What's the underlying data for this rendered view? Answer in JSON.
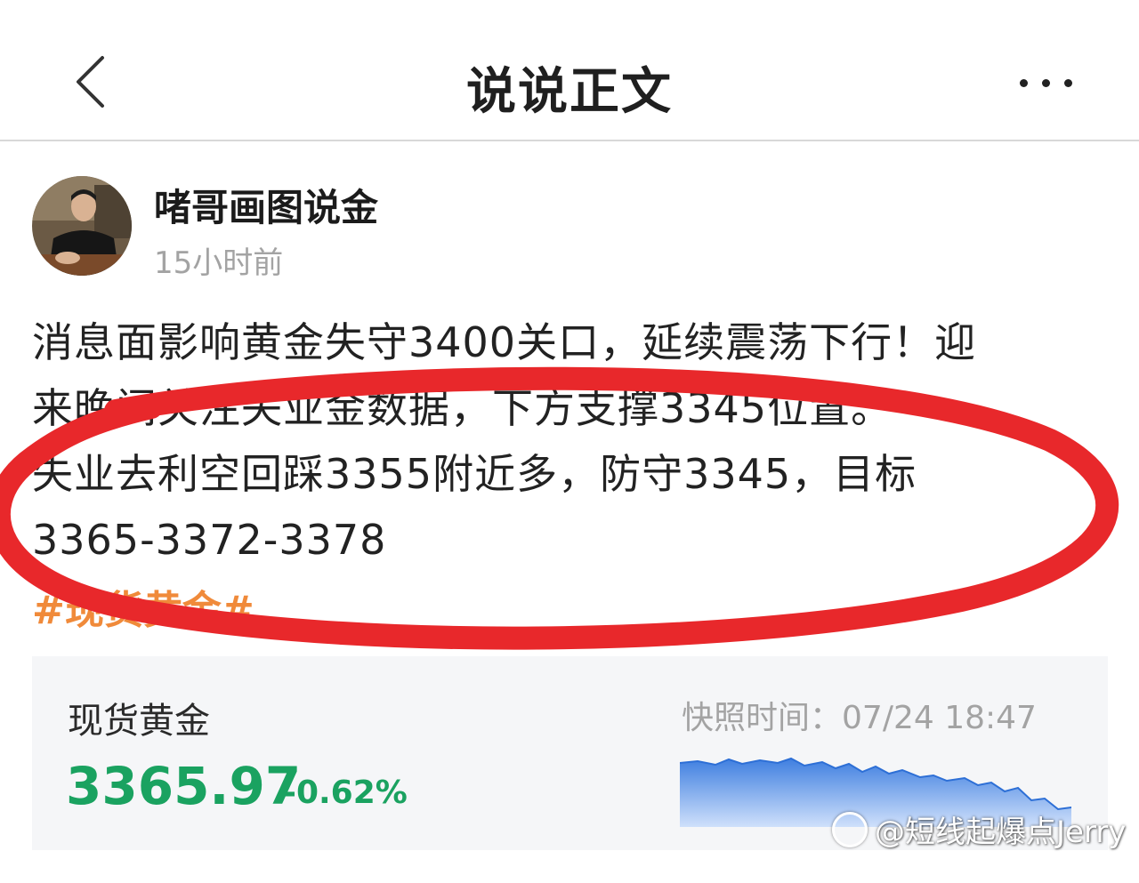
{
  "header": {
    "title": "说说正文",
    "back_icon": "chevron-left-icon",
    "more_icon": "more-horizontal-icon"
  },
  "post": {
    "author": "啫哥画图说金",
    "time": "15小时前",
    "lines": [
      "消息面影响黄金失守3400关口，延续震荡下行！迎",
      "来晚间关注失业金数据，下方支撑3345位置。",
      "失业去利空回踩3355附近多，防守3345，目标",
      "3365-3372-3378"
    ],
    "hashtag": "#现货黄金#"
  },
  "quote_card": {
    "name": "现货黄金",
    "price": "3365.97",
    "change": "-0.62%",
    "snapshot_label": "快照时间：",
    "snapshot_time": "07/24 18:47",
    "color": "#1aa260"
  },
  "annotation": {
    "color": "#e8282b",
    "shape": "hand-drawn ellipse"
  },
  "watermark": {
    "text": "@短线起爆点Jerry"
  }
}
